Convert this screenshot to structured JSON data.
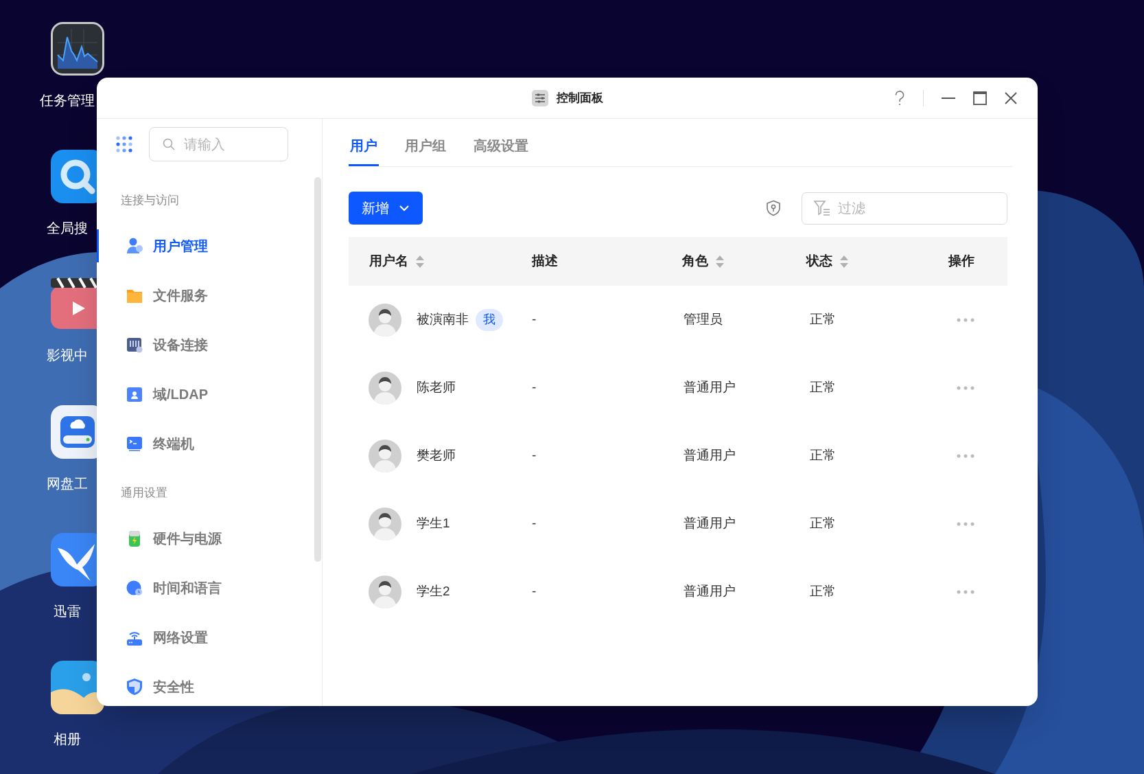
{
  "desktop": {
    "icons": [
      {
        "label": "任务管理",
        "kind": "monitor"
      },
      {
        "label": "全局搜",
        "kind": "search"
      },
      {
        "label": "影视中",
        "kind": "video"
      },
      {
        "label": "网盘工",
        "kind": "drive"
      },
      {
        "label": "迅雷",
        "kind": "bird"
      },
      {
        "label": "相册",
        "kind": "photos"
      }
    ]
  },
  "window": {
    "title": "控制面板"
  },
  "sidebar": {
    "search": {
      "placeholder": "请输入"
    },
    "sections": [
      {
        "heading": "连接与访问",
        "items": [
          {
            "label": "用户管理",
            "kind": "user",
            "selected": true
          },
          {
            "label": "文件服务",
            "kind": "folder",
            "selected": false
          },
          {
            "label": "设备连接",
            "kind": "device",
            "selected": false
          },
          {
            "label": "域/LDAP",
            "kind": "ldap",
            "selected": false
          },
          {
            "label": "终端机",
            "kind": "terminal",
            "selected": false
          }
        ]
      },
      {
        "heading": "通用设置",
        "items": [
          {
            "label": "硬件与电源",
            "kind": "battery",
            "selected": false
          },
          {
            "label": "时间和语言",
            "kind": "globe",
            "selected": false
          },
          {
            "label": "网络设置",
            "kind": "router",
            "selected": false
          },
          {
            "label": "安全性",
            "kind": "shield",
            "selected": false
          }
        ]
      }
    ]
  },
  "tabs": [
    {
      "label": "用户",
      "selected": true
    },
    {
      "label": "用户组",
      "selected": false
    },
    {
      "label": "高级设置",
      "selected": false
    }
  ],
  "toolbar": {
    "add_button": "新增",
    "filter": {
      "placeholder": "过滤"
    }
  },
  "table": {
    "columns": [
      {
        "label": "用户名",
        "sortable": true
      },
      {
        "label": "描述",
        "sortable": false
      },
      {
        "label": "角色",
        "sortable": true
      },
      {
        "label": "状态",
        "sortable": true
      },
      {
        "label": "操作",
        "sortable": false
      }
    ],
    "rows": [
      {
        "username": "被演南非",
        "badge": "我",
        "description": "-",
        "role": "管理员",
        "status": "正常"
      },
      {
        "username": "陈老师",
        "description": "-",
        "role": "普通用户",
        "status": "正常"
      },
      {
        "username": "樊老师",
        "description": "-",
        "role": "普通用户",
        "status": "正常"
      },
      {
        "username": "学生1",
        "description": "-",
        "role": "普通用户",
        "status": "正常"
      },
      {
        "username": "学生2",
        "description": "-",
        "role": "普通用户",
        "status": "正常"
      }
    ]
  }
}
